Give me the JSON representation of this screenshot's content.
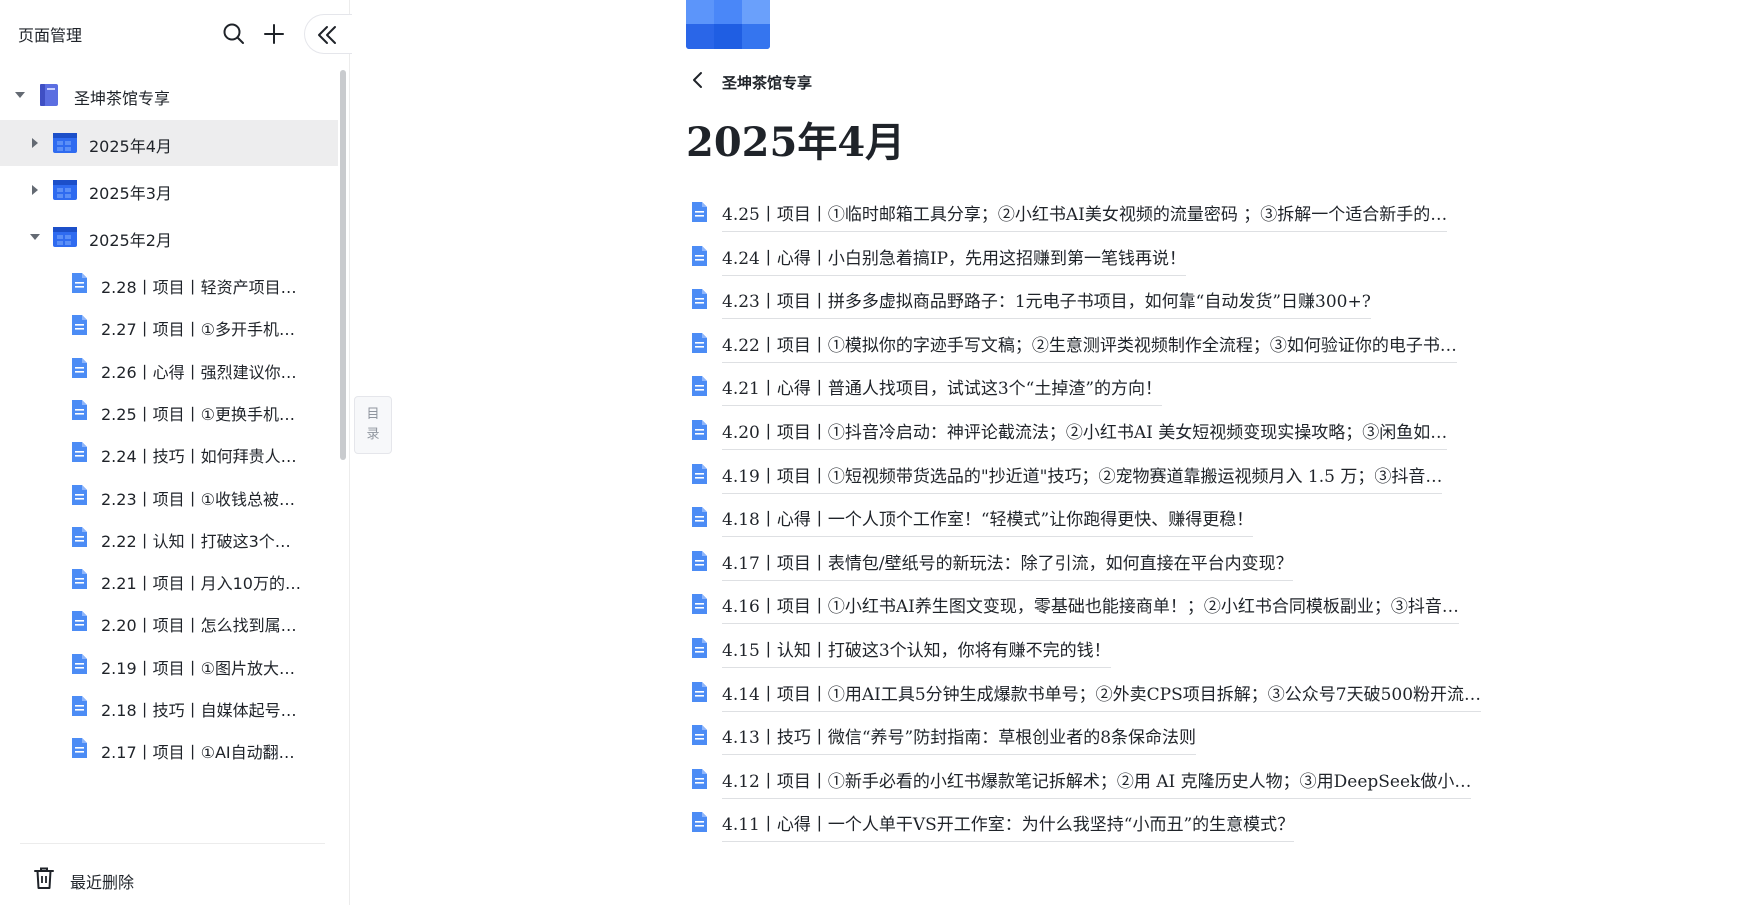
{
  "sidebar": {
    "title": "页面管理",
    "root": {
      "label": "圣坤茶馆专享"
    },
    "months": [
      {
        "label": "2025年4月"
      },
      {
        "label": "2025年3月"
      },
      {
        "label": "2025年2月"
      }
    ],
    "feb_items": [
      {
        "label": "2.28丨项目丨轻资产项目…"
      },
      {
        "label": "2.27丨项目丨①多开手机…"
      },
      {
        "label": "2.26丨心得丨强烈建议你…"
      },
      {
        "label": "2.25丨项目丨①更换手机…"
      },
      {
        "label": "2.24丨技巧丨如何拜贵人…"
      },
      {
        "label": "2.23丨项目丨①收钱总被…"
      },
      {
        "label": "2.22丨认知丨打破这3个…"
      },
      {
        "label": "2.21丨项目丨月入10万的…"
      },
      {
        "label": "2.20丨项目丨怎么找到属…"
      },
      {
        "label": "2.19丨项目丨①图片放大…"
      },
      {
        "label": "2.18丨技巧丨自媒体起号…"
      },
      {
        "label": "2.17丨项目丨①AI自动翻…"
      }
    ],
    "trash_label": "最近删除"
  },
  "toc_tab": {
    "line1": "目",
    "line2": "录"
  },
  "main": {
    "breadcrumb": "圣坤茶馆专享",
    "title": "2025年4月",
    "docs": [
      {
        "text": "4.25丨项目丨①临时邮箱工具分享；②小红书AI美女视频的流量密码 ；③拆解一个适合新手的…"
      },
      {
        "text": "4.24丨心得丨小白别急着搞IP，先用这招赚到第一笔钱再说！"
      },
      {
        "text": "4.23丨项目丨拼多多虚拟商品野路子：1元电子书项目，如何靠“自动发货”日赚300+?"
      },
      {
        "text": "4.22丨项目丨①模拟你的字迹手写文稿；②生意测评类视频制作全流程；③如何验证你的电子书…"
      },
      {
        "text": "4.21丨心得丨普通人找项目，试试这3个“土掉渣”的方向！"
      },
      {
        "text": "4.20丨项目丨①抖音冷启动：神评论截流法；②小红书AI 美女短视频变现实操攻略；③闲鱼如…"
      },
      {
        "text": "4.19丨项目丨①短视频带货选品的\"抄近道\"技巧；②宠物赛道靠搬运视频月入 1.5 万；③抖音…"
      },
      {
        "text": "4.18丨心得丨一个人顶个工作室！“轻模式”让你跑得更快、赚得更稳！"
      },
      {
        "text": "4.17丨项目丨表情包/壁纸号的新玩法：除了引流，如何直接在平台内变现？"
      },
      {
        "text": "4.16丨项目丨①小红书AI养生图文变现，零基础也能接商单！；②小红书合同模板副业；③抖音…"
      },
      {
        "text": "4.15丨认知丨打破这3个认知，你将有赚不完的钱！"
      },
      {
        "text": "4.14丨项目丨①用AI工具5分钟生成爆款书单号；②外卖CPS项目拆解；③公众号7天破500粉开流…"
      },
      {
        "text": "4.13丨技巧丨微信“养号”防封指南：草根创业者的8条保命法则"
      },
      {
        "text": "4.12丨项目丨①新手必看的小红书爆款笔记拆解术；②用 AI 克隆历史人物；③用DeepSeek做小…"
      },
      {
        "text": "4.11丨心得丨一个人单干VS开工作室：为什么我坚持“小而丑”的生意模式？"
      }
    ]
  },
  "colors": {
    "accent": "#3370ff",
    "doc_icon": "#4c8cf5",
    "selected_bg": "#ededee"
  }
}
